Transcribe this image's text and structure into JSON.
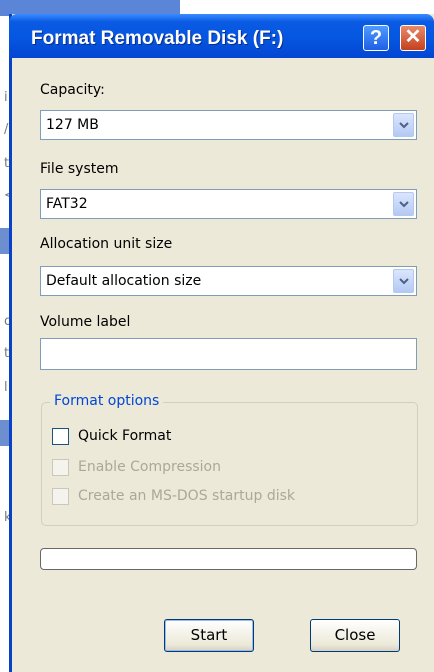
{
  "window": {
    "title": "Format Removable Disk (F:)",
    "help_glyph": "?",
    "close_glyph": "✕"
  },
  "capacity": {
    "label": "Capacity:",
    "value": "127 MB"
  },
  "file_system": {
    "label": "File system",
    "value": "FAT32"
  },
  "allocation": {
    "label": "Allocation unit size",
    "value": "Default allocation size"
  },
  "volume": {
    "label": "Volume label",
    "value": ""
  },
  "format_options": {
    "legend": "Format options",
    "quick_format": {
      "label": "Quick Format",
      "checked": false,
      "enabled": true
    },
    "enable_compression": {
      "label": "Enable Compression",
      "checked": false,
      "enabled": false
    },
    "msdos_startup": {
      "label": "Create an MS-DOS startup disk",
      "checked": false,
      "enabled": false
    }
  },
  "progress": {
    "fraction": 0
  },
  "buttons": {
    "start": "Start",
    "close": "Close"
  },
  "background_window": {
    "glyphs": [
      "i",
      "/",
      "t",
      "<",
      "o",
      "t",
      "l",
      "k"
    ]
  },
  "colors": {
    "titlebar": "#0556e0",
    "dialog_face": "#ece9d8",
    "group_legend": "#0046d5",
    "disabled_text": "#aca899",
    "progress_fill": "#3ac33a"
  }
}
